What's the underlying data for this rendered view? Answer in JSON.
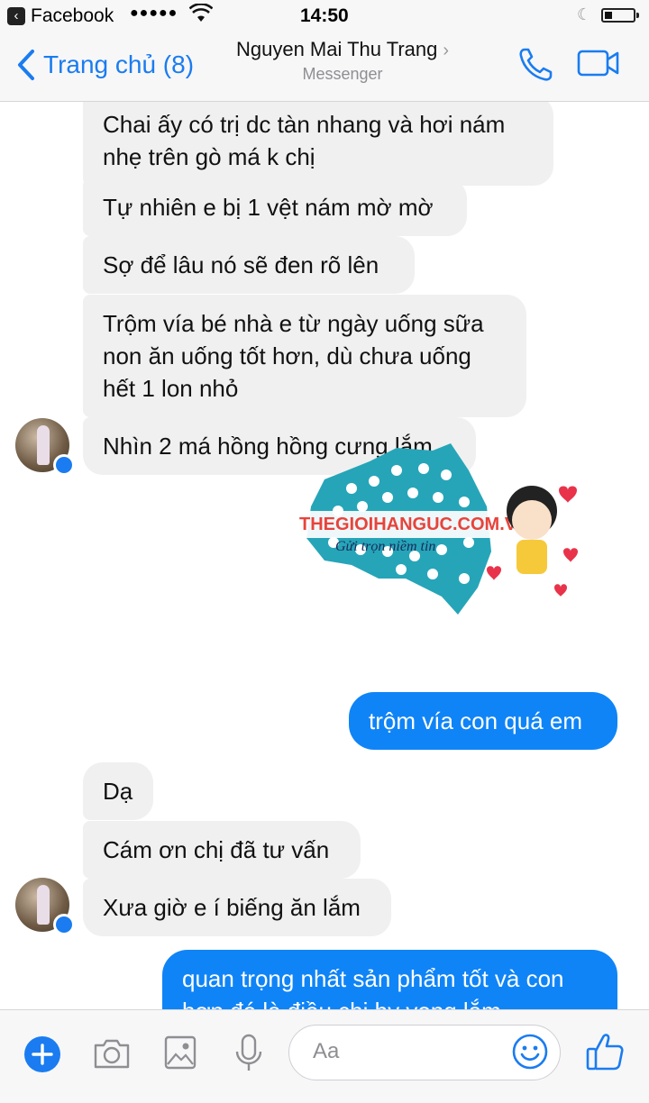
{
  "status_bar": {
    "back_app": "Facebook",
    "signal": "●●●●●",
    "time": "14:50"
  },
  "nav": {
    "back_label": "Trang chủ (8)",
    "contact_name": "Nguyen Mai Thu Trang",
    "subtitle": "Messenger"
  },
  "messages": [
    {
      "from": "them",
      "text": "Chai ấy có trị dc tàn nhang và hơi nám nhẹ trên gò má k chị"
    },
    {
      "from": "them",
      "text": "Tự nhiên e bị 1 vệt nám mờ mờ"
    },
    {
      "from": "them",
      "text": "Sợ để lâu nó sẽ đen rõ lên"
    },
    {
      "from": "them",
      "text": "Trộm vía bé nhà e từ ngày uống sữa non ăn uống tốt hơn, dù chưa uống hết 1 lon nhỏ"
    },
    {
      "from": "them",
      "text": "Nhìn 2 má hồng hồng cưng lắm"
    },
    {
      "from": "me",
      "text": "trộm vía con quá em"
    },
    {
      "from": "them",
      "text": "Dạ"
    },
    {
      "from": "them",
      "text": "Cám ơn chị đã tư vấn"
    },
    {
      "from": "them",
      "text": "Xưa giờ e í biếng ăn lắm"
    },
    {
      "from": "me",
      "text": "quan trọng nhất sản phẩm tốt và con hơn đó là điều chị hy vọng lắm"
    }
  ],
  "sticker": {
    "brand": "THEGIOIHANGUC.COM.VN",
    "slogan": "Gửi trọn niềm tin"
  },
  "composer": {
    "placeholder": "Aa"
  },
  "colors": {
    "accent": "#1a7cf0",
    "outgoing_bubble": "#0f84f7",
    "incoming_bubble": "#f0f0f0",
    "sticker_teal": "#26a5b8"
  },
  "icons": [
    "plus-icon",
    "camera-icon",
    "image-icon",
    "microphone-icon",
    "emoji-icon",
    "thumbs-up-icon",
    "phone-icon",
    "video-icon"
  ]
}
